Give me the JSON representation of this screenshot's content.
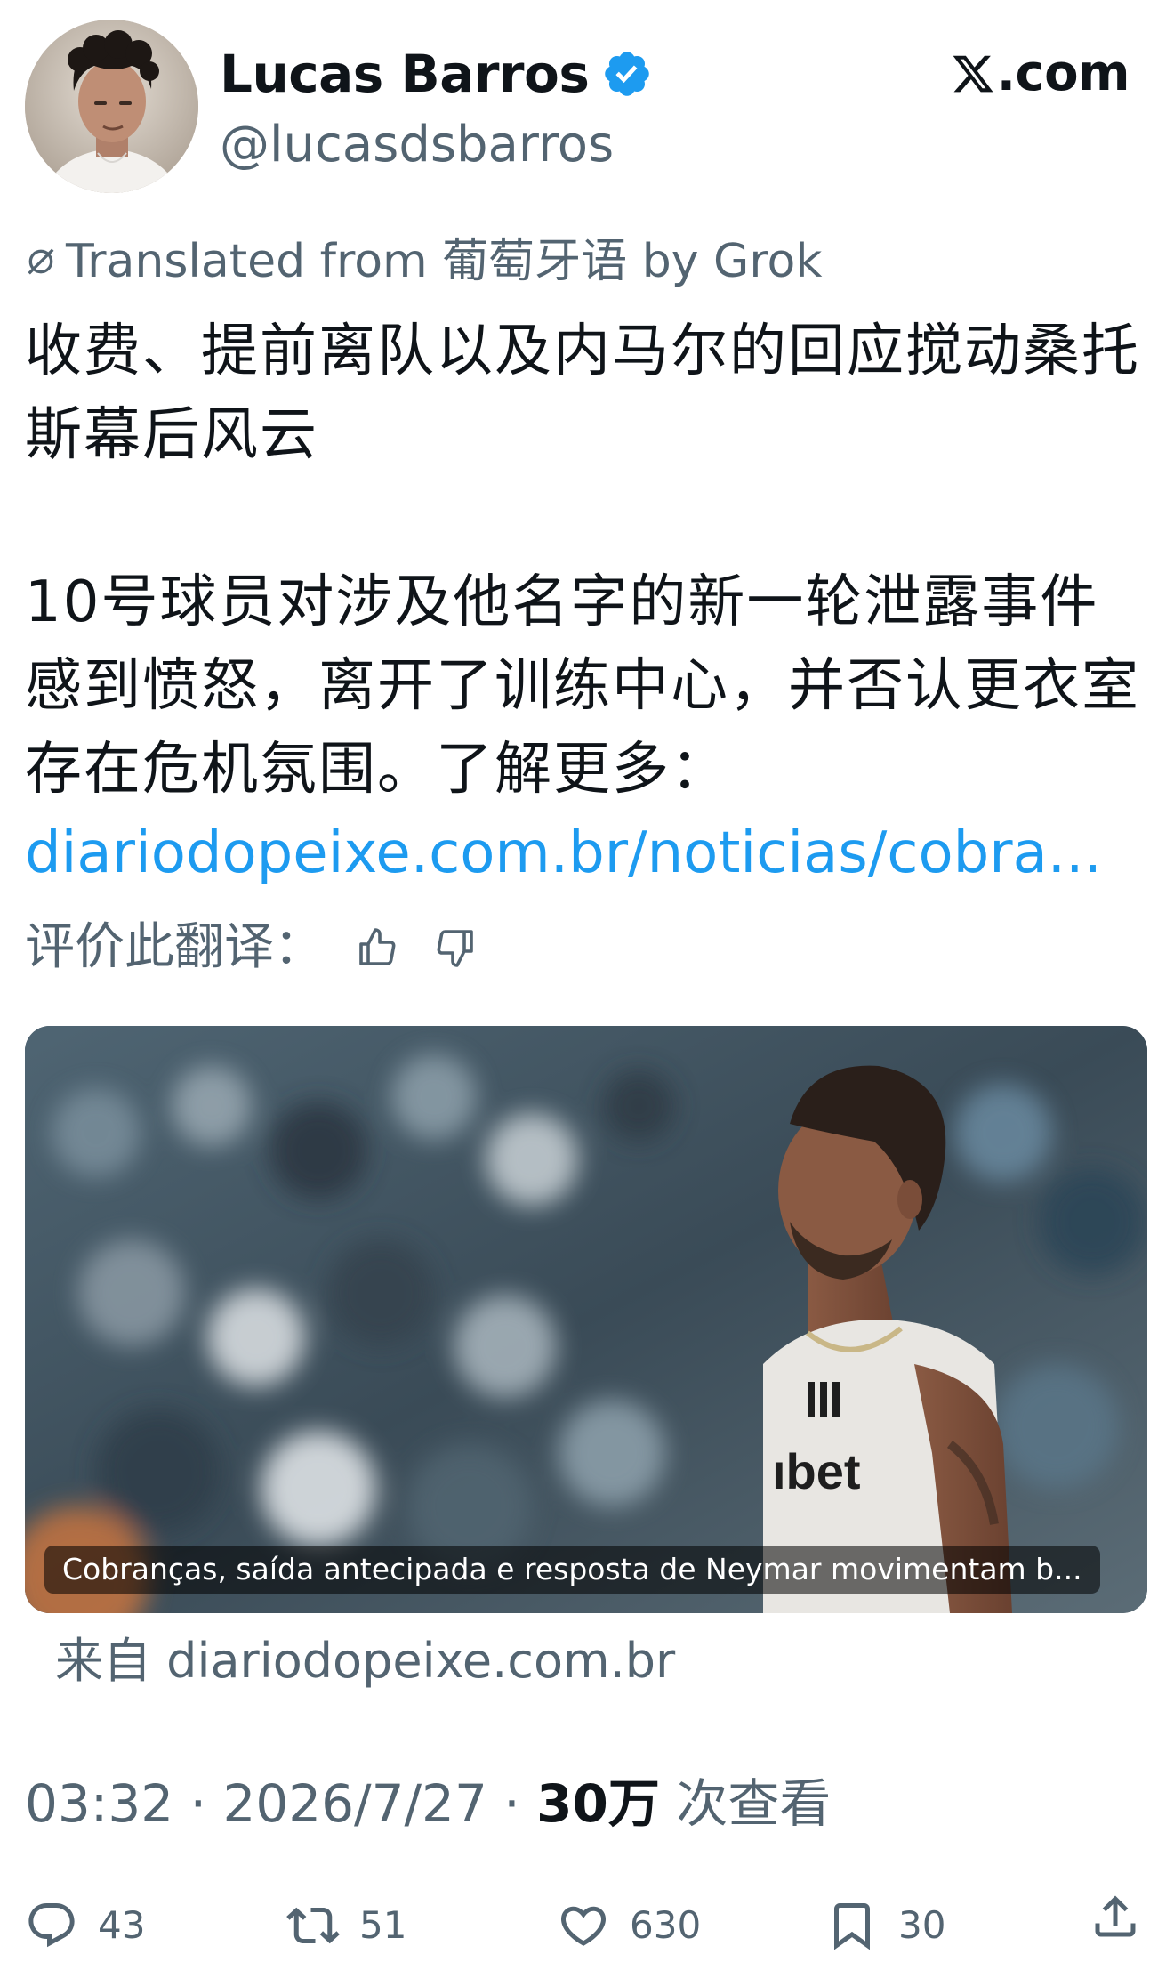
{
  "header": {
    "display_name": "Lucas Barros",
    "handle": "@lucasdsbarros",
    "brand": ".com"
  },
  "translation": {
    "note": "Translated from 葡萄牙语 by Grok",
    "rate_label": "评价此翻译："
  },
  "tweet": {
    "paragraph_1": "收费、提前离队以及内马尔的回应搅动桑托斯幕后风云",
    "paragraph_2": "10号球员对涉及他名字的新一轮泄露事件感到愤怒，离开了训练中心，并否认更衣室存在危机氛围。了解更多：",
    "link_text": "diariodopeixe.com.br/noticias/cobra..."
  },
  "card": {
    "caption": "Cobranças, saída antecipada e resposta de Neymar movimentam b...",
    "source": "来自 diariodopeixe.com.br"
  },
  "meta": {
    "time": "03:32 · 2026/7/27 · ",
    "views_count": "30万",
    "views_label": " 次查看"
  },
  "actions": {
    "replies": "43",
    "reposts": "51",
    "likes": "630",
    "bookmarks": "30"
  },
  "colors": {
    "link": "#1d9bf0",
    "verified": "#1d9bf0",
    "muted": "#536471"
  }
}
